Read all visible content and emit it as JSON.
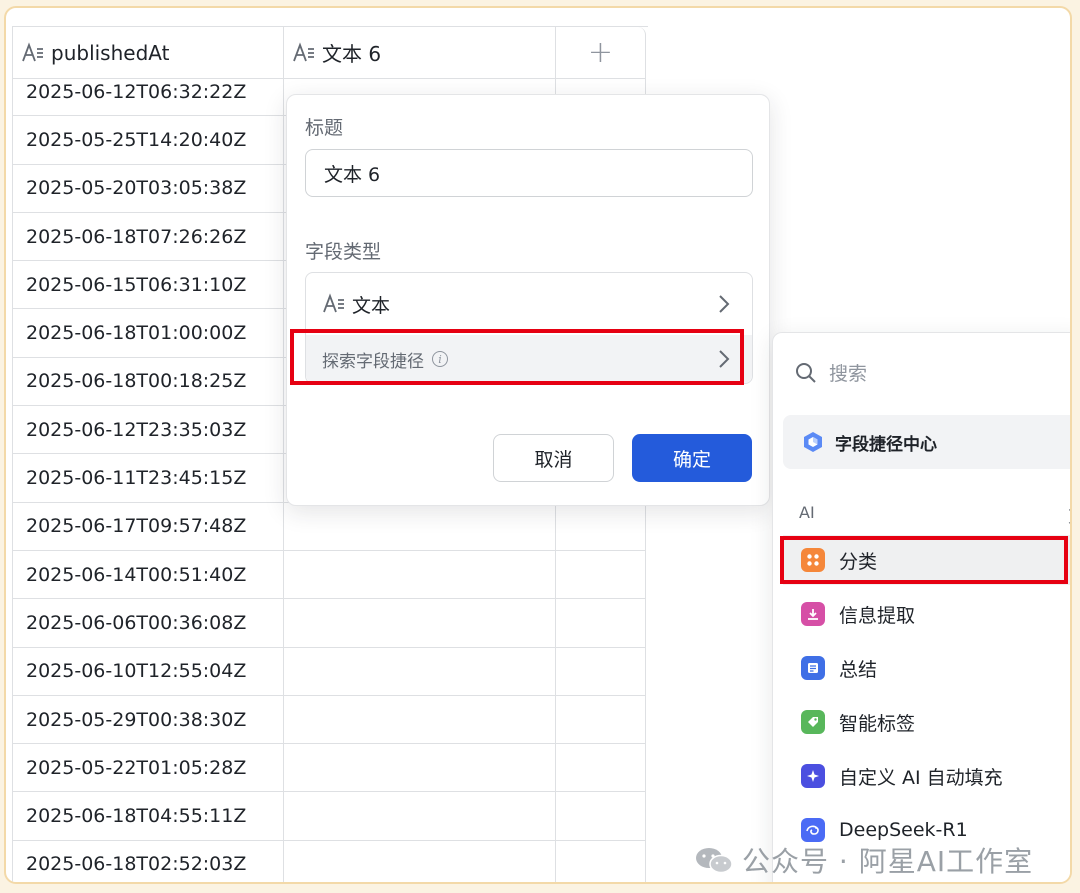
{
  "table": {
    "columns": [
      {
        "label": "publishedAt",
        "icon": "text-field-icon"
      },
      {
        "label": "文本 6",
        "icon": "text-field-icon"
      }
    ],
    "add_column_icon": "plus-icon",
    "rows": [
      "2025-06-12T06:32:22Z",
      "2025-05-25T14:20:40Z",
      "2025-05-20T03:05:38Z",
      "2025-06-18T07:26:26Z",
      "2025-06-15T06:31:10Z",
      "2025-06-18T01:00:00Z",
      "2025-06-18T00:18:25Z",
      "2025-06-12T23:35:03Z",
      "2025-06-11T23:45:15Z",
      "2025-06-17T09:57:48Z",
      "2025-06-14T00:51:40Z",
      "2025-06-06T00:36:08Z",
      "2025-06-10T12:55:04Z",
      "2025-05-29T00:38:30Z",
      "2025-05-22T01:05:28Z",
      "2025-06-18T04:55:11Z",
      "2025-06-18T02:52:03Z"
    ]
  },
  "popover": {
    "title_label": "标题",
    "title_value": "文本 6",
    "type_label": "字段类型",
    "type_value": "文本",
    "shortcut_label": "探索字段捷径",
    "cancel_label": "取消",
    "confirm_label": "确定"
  },
  "panel": {
    "search_placeholder": "搜索",
    "center_label": "字段捷径中心",
    "section_label": "AI",
    "more_label": "更",
    "items": [
      {
        "label": "分类",
        "icon": "classify-icon",
        "color": "#f5873a"
      },
      {
        "label": "信息提取",
        "icon": "extract-icon",
        "color": "#d64fa6"
      },
      {
        "label": "总结",
        "icon": "summary-icon",
        "color": "#3f6fe6"
      },
      {
        "label": "智能标签",
        "icon": "tag-icon",
        "color": "#58b75b"
      },
      {
        "label": "自定义 AI 自动填充",
        "icon": "sparkle-icon",
        "color": "#4b4fe0"
      },
      {
        "label": "DeepSeek-R1",
        "icon": "deepseek-icon",
        "color": "#4b6bf5"
      }
    ]
  },
  "watermark": "公众号 · 阿星AI工作室",
  "colors": {
    "accent": "#245bdb",
    "highlight": "#e60012"
  }
}
